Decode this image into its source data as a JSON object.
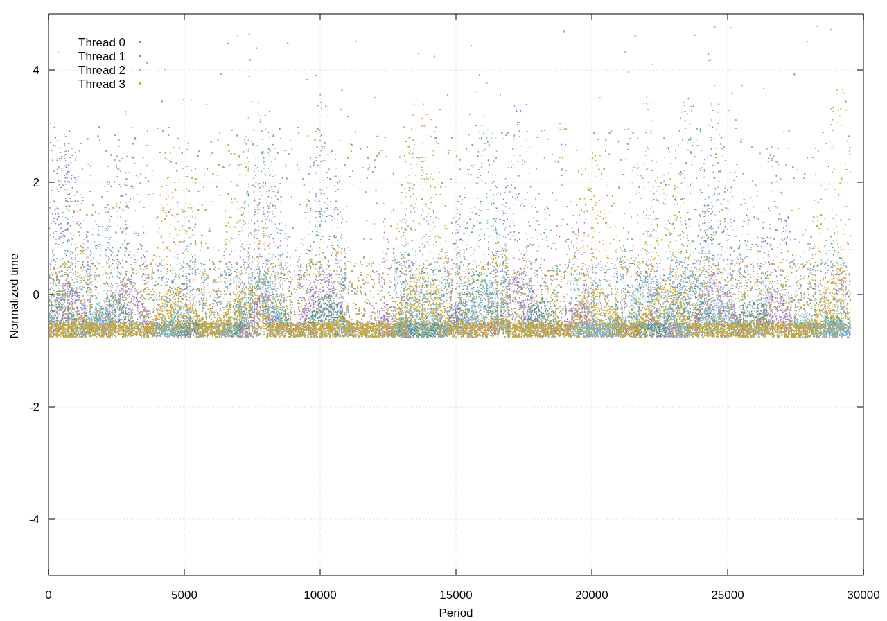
{
  "plot": {
    "x_title": "Period",
    "y_title": "Normalized time",
    "x_ticks": [
      "0",
      "5000",
      "10000",
      "15000",
      "20000",
      "25000",
      "30000"
    ],
    "y_ticks": [
      "4",
      "2",
      "0",
      "-2",
      "-4"
    ],
    "legend": [
      {
        "label": "Thread 0",
        "color": "#a070d8"
      },
      {
        "label": "Thread 1",
        "color": "#4a9e8e"
      },
      {
        "label": "Thread 2",
        "color": "#7abedd"
      },
      {
        "label": "Thread 3",
        "color": "#daa520"
      }
    ]
  }
}
